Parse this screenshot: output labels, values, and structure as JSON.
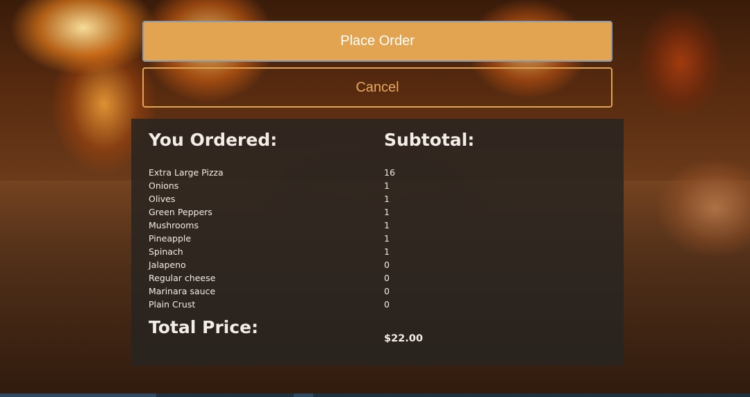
{
  "actions": {
    "place_order_label": "Place Order",
    "cancel_label": "Cancel"
  },
  "summary": {
    "ordered_heading": "You Ordered:",
    "subtotal_heading": "Subtotal:",
    "total_heading": "Total Price:",
    "total_value": "$22.00",
    "items": [
      {
        "name": "Extra Large Pizza",
        "subtotal": "16"
      },
      {
        "name": "Onions",
        "subtotal": "1"
      },
      {
        "name": "Olives",
        "subtotal": "1"
      },
      {
        "name": "Green Peppers",
        "subtotal": "1"
      },
      {
        "name": "Mushrooms",
        "subtotal": "1"
      },
      {
        "name": "Pineapple",
        "subtotal": "1"
      },
      {
        "name": "Spinach",
        "subtotal": "1"
      },
      {
        "name": "Jalapeno",
        "subtotal": "0"
      },
      {
        "name": "Regular cheese",
        "subtotal": "0"
      },
      {
        "name": "Marinara sauce",
        "subtotal": "0"
      },
      {
        "name": "Plain Crust",
        "subtotal": "0"
      }
    ]
  },
  "colors": {
    "accent": "#e2a450",
    "panel_bg": "#282421",
    "text": "#f2ede6"
  }
}
